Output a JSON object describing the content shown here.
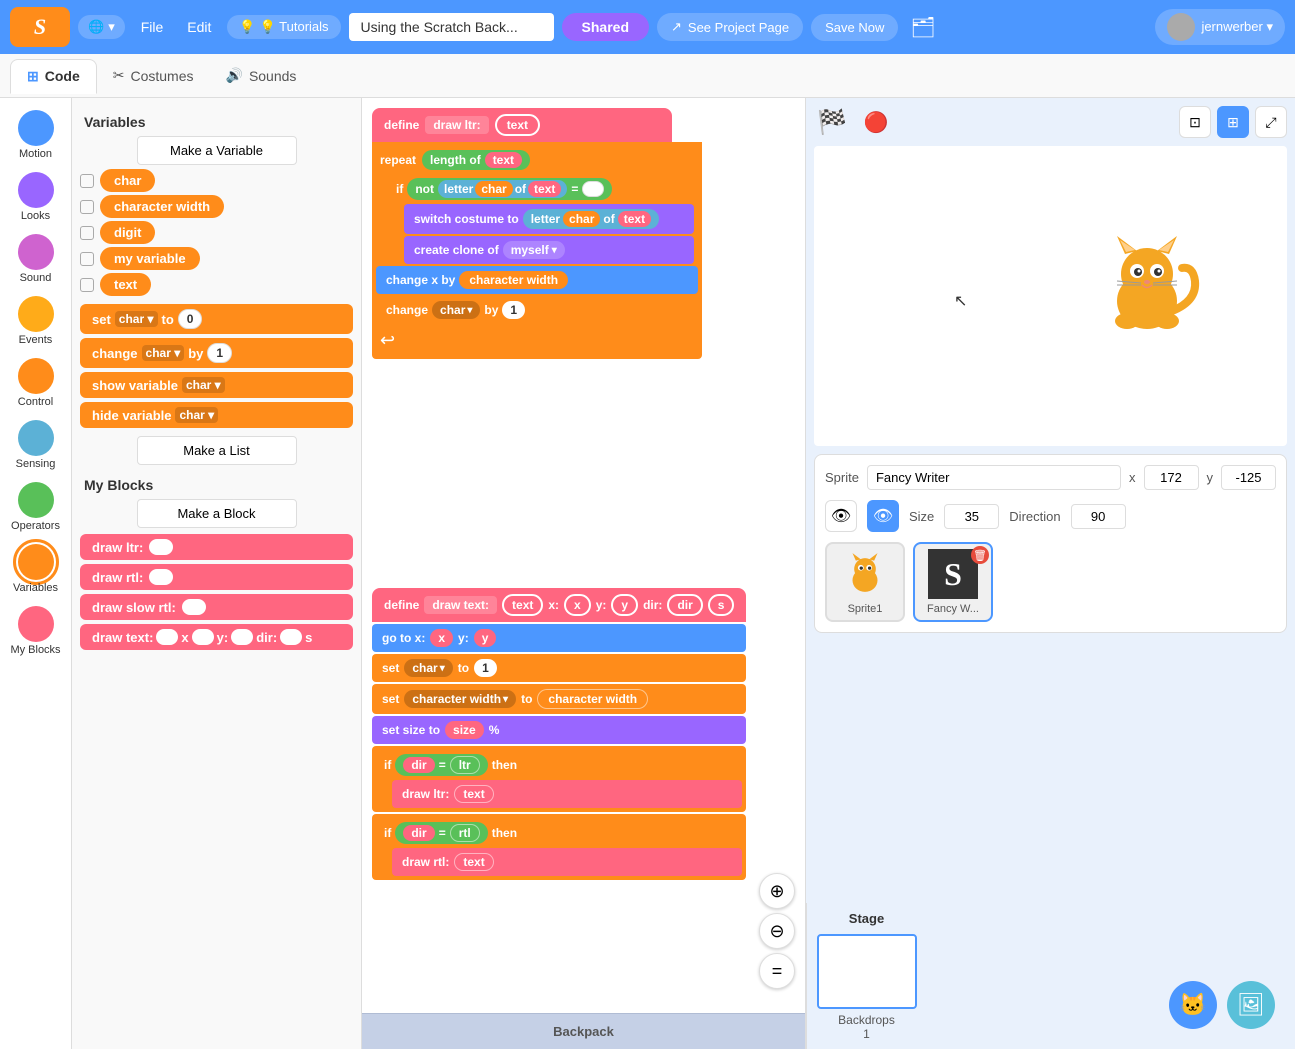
{
  "topnav": {
    "logo": "Scratch",
    "globe_label": "🌐 ▾",
    "file_label": "File",
    "edit_label": "Edit",
    "tutorials_label": "💡 Tutorials",
    "project_title": "Using the Scratch Back...",
    "shared_label": "Shared",
    "see_project_label": "See Project Page",
    "save_label": "Save Now",
    "folder_icon": "🗂",
    "user_label": "jernwerber ▾"
  },
  "tabs": {
    "code": "Code",
    "costumes": "Costumes",
    "sounds": "Sounds"
  },
  "categories": [
    {
      "name": "Motion",
      "color": "#4c97ff"
    },
    {
      "name": "Looks",
      "color": "#9966ff"
    },
    {
      "name": "Sound",
      "color": "#cf63cf"
    },
    {
      "name": "Events",
      "color": "#ffab19"
    },
    {
      "name": "Control",
      "color": "#ff8c1a"
    },
    {
      "name": "Sensing",
      "color": "#5cb1d6"
    },
    {
      "name": "Operators",
      "color": "#59c059"
    },
    {
      "name": "Variables",
      "color": "#ff8c1a"
    },
    {
      "name": "My Blocks",
      "color": "#ff6680"
    }
  ],
  "variables_section": {
    "title": "Variables",
    "make_var_btn": "Make a Variable",
    "vars": [
      {
        "name": "char"
      },
      {
        "name": "character width"
      },
      {
        "name": "digit"
      },
      {
        "name": "my variable"
      },
      {
        "name": "text"
      }
    ],
    "set_block": "set",
    "set_var": "char",
    "set_to": "to",
    "set_val": "0",
    "change_block": "change",
    "change_var": "char",
    "change_by": "by",
    "change_val": "1",
    "show_var": "show variable",
    "hide_var": "hide variable",
    "make_list_btn": "Make a List"
  },
  "my_blocks_section": {
    "title": "My Blocks",
    "make_block_btn": "Make a Block",
    "blocks": [
      {
        "label": "draw ltr:",
        "has_oval": true
      },
      {
        "label": "draw rtl:",
        "has_oval": true
      },
      {
        "label": "draw slow rtl:",
        "has_oval": true
      },
      {
        "label": "draw text:",
        "has_ovals": true,
        "extra": "x y dir s"
      }
    ]
  },
  "scripts": {
    "group1": {
      "blocks": [
        {
          "type": "define",
          "text": "define  draw ltr:  text"
        },
        {
          "type": "repeat",
          "oval": "length of  text"
        },
        {
          "type": "if",
          "cond": "not  letter  char  of  text  =  □"
        },
        {
          "type": "switch",
          "text": "switch costume to  letter  char  of  text"
        },
        {
          "type": "create",
          "text": "create clone of  myself ▾"
        },
        {
          "type": "change_x",
          "text": "change x by  character width"
        },
        {
          "type": "change",
          "text": "change  char ▾  by  1"
        }
      ]
    },
    "group2": {
      "blocks": [
        {
          "type": "define",
          "text": "define  draw text:  text  x:  x  y:  y  dir:  dir  s"
        },
        {
          "type": "goto",
          "text": "go to x:  x  y:  y"
        },
        {
          "type": "set",
          "text": "set  char ▾  to  1"
        },
        {
          "type": "set",
          "text": "set  character width ▾  to  character width"
        },
        {
          "type": "set_size",
          "text": "set size to  size  %"
        },
        {
          "type": "if",
          "cond": "dir  =  ltr  then"
        },
        {
          "type": "call",
          "text": "draw ltr:  text"
        },
        {
          "type": "if",
          "cond": "dir  =  rtl  then"
        },
        {
          "type": "call",
          "text": "draw rtl:  text"
        }
      ]
    },
    "letter_s": "S"
  },
  "stage": {
    "flag_icon": "🏁",
    "stop_icon": "⬛",
    "sprite_label": "Sprite",
    "sprite_name": "Fancy Writer",
    "x_label": "x",
    "x_val": "172",
    "y_label": "y",
    "y_val": "-125",
    "size_label": "Size",
    "size_val": "35",
    "direction_label": "Direction",
    "direction_val": "90",
    "sprites": [
      {
        "name": "Sprite1",
        "label": "Sprite1"
      },
      {
        "name": "Fancy W...",
        "label": "Fancy W...",
        "selected": true
      }
    ],
    "stage_label": "Stage",
    "backdrops_label": "Backdrops",
    "backdrops_count": "1"
  },
  "backpack": {
    "label": "Backpack"
  },
  "zoom": {
    "plus": "+",
    "minus": "−",
    "reset": "="
  }
}
